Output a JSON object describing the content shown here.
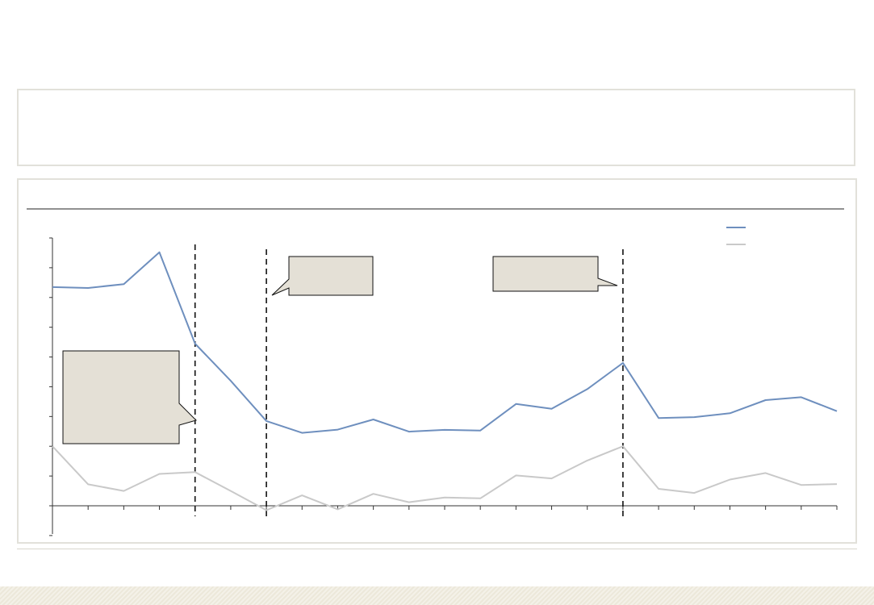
{
  "colors": {
    "primary_series": "#6e8fbe",
    "secondary_series": "#c9c9c9",
    "callout_fill": "#e4e0d6",
    "panel_border": "#e2e1da"
  },
  "chart_data": {
    "type": "line",
    "title": "",
    "xlabel": "",
    "ylabel": "",
    "grid": false,
    "legend": "top-right",
    "x": [
      0,
      1,
      2,
      3,
      4,
      5,
      6,
      7,
      8,
      9,
      10,
      11,
      12,
      13,
      14,
      15,
      16,
      17,
      18,
      19,
      20,
      21,
      22
    ],
    "ylim": [
      0,
      9
    ],
    "series": [
      {
        "values": [
          7.35,
          7.32,
          7.45,
          8.52,
          5.45,
          4.2,
          2.85,
          2.45,
          2.56,
          2.9,
          2.49,
          2.55,
          2.53,
          3.42,
          3.26,
          3.92,
          4.8,
          2.95,
          2.98,
          3.11,
          3.55,
          3.65,
          3.18
        ]
      },
      {
        "values": [
          2.0,
          0.72,
          0.5,
          1.07,
          1.13,
          0.5,
          -0.15,
          0.35,
          -0.12,
          0.4,
          0.12,
          0.28,
          0.25,
          1.02,
          0.92,
          1.52,
          2.0,
          0.57,
          0.43,
          0.88,
          1.1,
          0.7,
          0.73
        ]
      }
    ],
    "vertical_markers": [
      4,
      6,
      16
    ],
    "annotations": [
      {
        "text": ""
      },
      {
        "text": ""
      },
      {
        "text": ""
      }
    ]
  }
}
